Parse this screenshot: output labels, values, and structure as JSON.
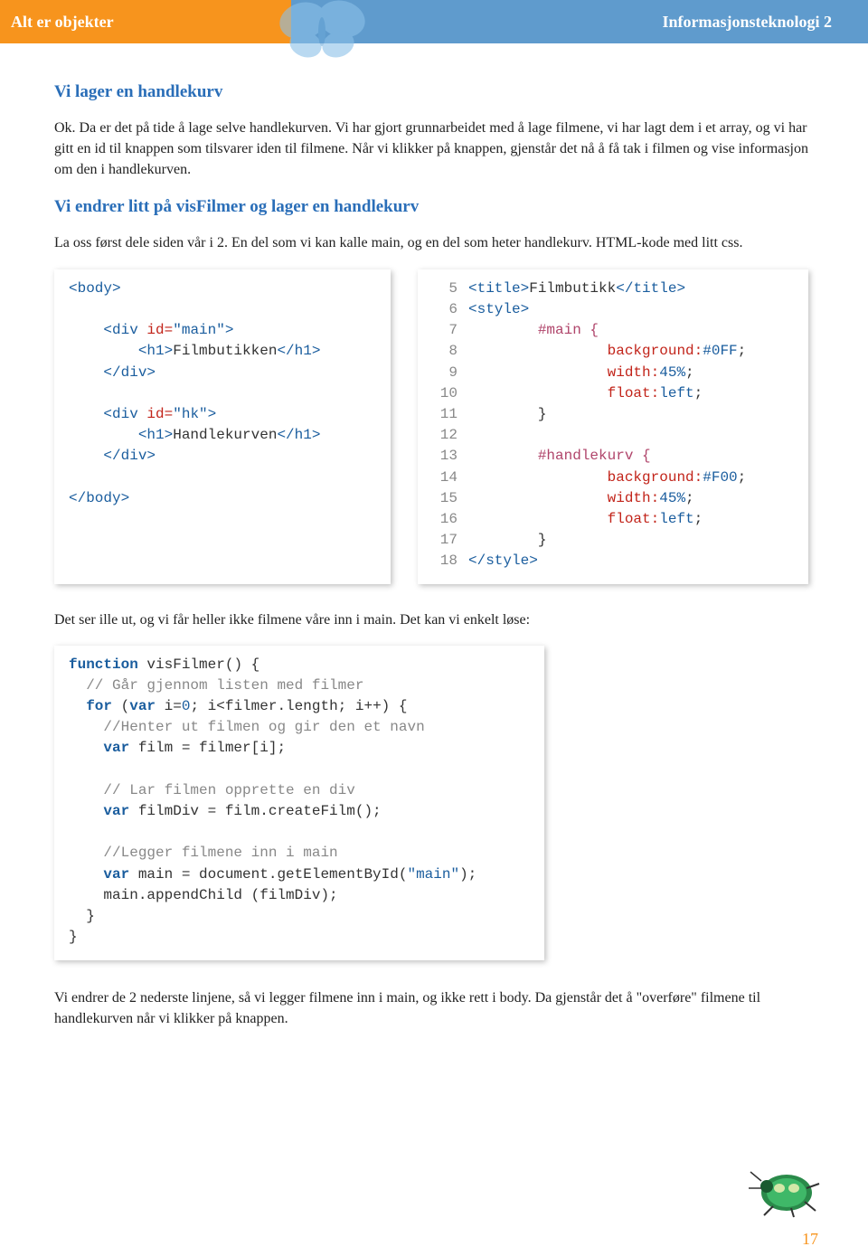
{
  "header": {
    "left": "Alt er objekter",
    "right": "Informasjonsteknologi 2"
  },
  "section1_title": "Vi lager en handlekurv",
  "para1": "Ok. Da er det på tide å lage selve handlekurven. Vi har gjort grunnarbeidet med å lage filmene, vi har lagt dem i et array, og vi har gitt en id til knappen som tilsvarer iden til filmene. Når vi klikker på knappen, gjenstår det nå å få tak i filmen og vise informasjon om den i handlekurven.",
  "section2_title": "Vi endrer litt på visFilmer  og lager en handlekurv",
  "para2": "La oss først dele siden vår i 2. En del som vi kan kalle main, og en del som heter handlekurv. HTML-kode med litt css.",
  "code_left": {
    "l1_open": "<body>",
    "l2": "",
    "l3_a": "    <div ",
    "l3_b": "id=",
    "l3_c": "\"main\"",
    "l3_d": ">",
    "l4_a": "        <h1>",
    "l4_b": "Filmbutikken",
    "l4_c": "</h1>",
    "l5": "    </div>",
    "l6": "",
    "l7_a": "    <div ",
    "l7_b": "id=",
    "l7_c": "\"hk\"",
    "l7_d": ">",
    "l8_a": "        <h1>",
    "l8_b": "Handlekurven",
    "l8_c": "</h1>",
    "l9": "    </div>",
    "l10": "",
    "l11": "</body>"
  },
  "code_right": {
    "ln": [
      "5",
      "6",
      "7",
      "8",
      "9",
      "10",
      "11",
      "12",
      "13",
      "14",
      "15",
      "16",
      "17",
      "18"
    ],
    "l5_a": "<title>",
    "l5_b": "Filmbutikk",
    "l5_c": "</title>",
    "l6": "<style>",
    "l7": "        #main {",
    "l8_a": "                background:",
    "l8_b": "#0FF",
    "l8_c": ";",
    "l9_a": "                width:",
    "l9_b": "45%",
    "l9_c": ";",
    "l10_a": "                float:",
    "l10_b": "left",
    "l10_c": ";",
    "l11": "        }",
    "l12": "",
    "l13": "        #handlekurv {",
    "l14_a": "                background:",
    "l14_b": "#F00",
    "l14_c": ";",
    "l15_a": "                width:",
    "l15_b": "45%",
    "l15_c": ";",
    "l16_a": "                float:",
    "l16_b": "left",
    "l16_c": ";",
    "l17": "        }",
    "l18": "</style>"
  },
  "para3": "Det ser ille ut, og vi får heller ikke filmene våre inn i main. Det kan vi enkelt løse:",
  "code_js": {
    "l1_a": "function ",
    "l1_b": "visFilmer() {",
    "l2": "  // Går gjennom listen med filmer",
    "l3_a": "  for ",
    "l3_b": "(",
    "l3_c": "var ",
    "l3_d": "i=",
    "l3_e": "0",
    "l3_f": "; i<filmer.length; i++) {",
    "l4": "    //Henter ut filmen og gir den et navn",
    "l5_a": "    var ",
    "l5_b": "film = filmer[i];",
    "l6": "",
    "l7": "    // Lar filmen opprette en div",
    "l8_a": "    var ",
    "l8_b": "filmDiv = film.createFilm();",
    "l9": "",
    "l10": "    //Legger filmene inn i main",
    "l11_a": "    var ",
    "l11_b": "main = document.getElementById(",
    "l11_c": "\"main\"",
    "l11_d": ");",
    "l12": "    main.appendChild (filmDiv);",
    "l13": "  }",
    "l14": "}"
  },
  "para4": "Vi endrer de 2 nederste linjene, så vi legger filmene inn i main, og ikke rett i body. Da gjenstår det å \"overføre\" filmene til handlekurven når vi klikker på knappen.",
  "page_number": "17"
}
